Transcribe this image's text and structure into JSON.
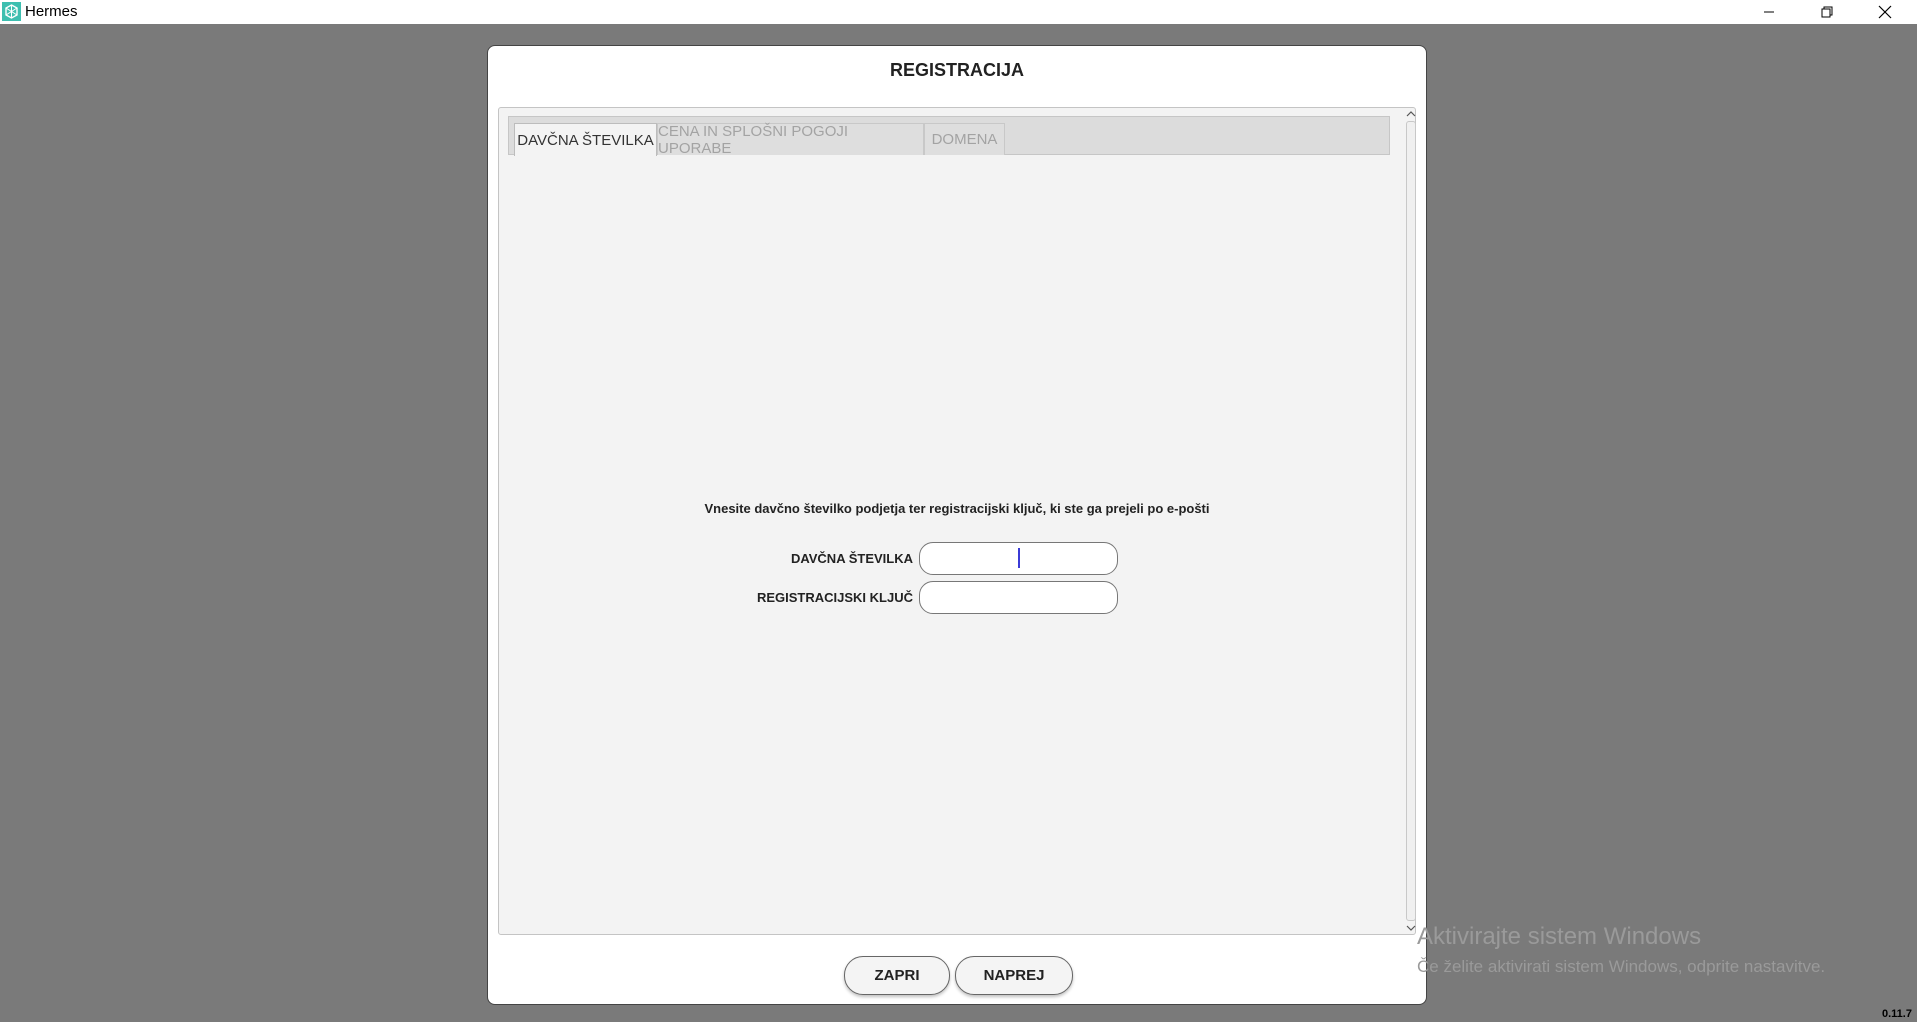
{
  "window": {
    "title": "Hermes",
    "controls": [
      "minimize-icon",
      "restore-icon",
      "close-icon"
    ]
  },
  "dialog": {
    "title": "REGISTRACIJA",
    "tabs": [
      {
        "label": "DAVČNA ŠTEVILKA",
        "active": true
      },
      {
        "label": "CENA IN SPLOŠNI POGOJI UPORABE",
        "active": false
      },
      {
        "label": "DOMENA",
        "active": false
      }
    ],
    "instruction": "Vnesite davčno številko podjetja ter registracijski ključ, ki ste ga prejeli po e-pošti",
    "fields": [
      {
        "label": "DAVČNA ŠTEVILKA",
        "value": ""
      },
      {
        "label": "REGISTRACIJSKI KLJUČ",
        "value": ""
      }
    ],
    "buttons": {
      "close_label": "ZAPRI",
      "next_label": "NAPREJ"
    }
  },
  "watermark": {
    "line1": "Aktivirajte sistem Windows",
    "line2": "Če želite aktivirati sistem Windows, odprite nastavitve."
  },
  "version": "0.11.7",
  "colors": {
    "backdrop": "#7a7a7a",
    "panel": "#f3f3f3",
    "caret": "#3b3bd6",
    "app_icon": "#3dbfb0"
  }
}
